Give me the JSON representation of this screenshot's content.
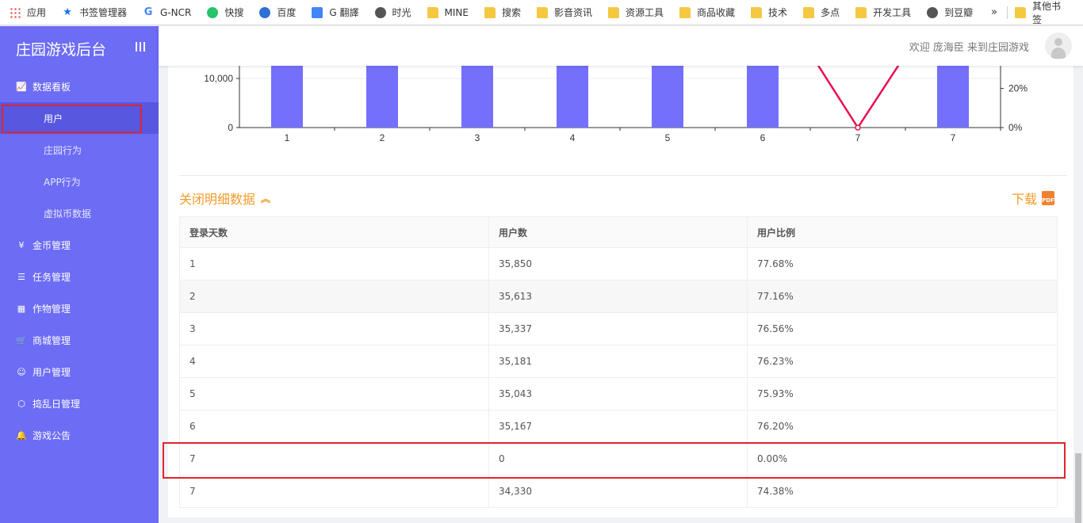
{
  "bookmarks": [
    {
      "label": "应用",
      "icon": "apps-grid-icon",
      "kind": "apps"
    },
    {
      "label": "书签管理器",
      "icon": "star-icon",
      "kind": "star"
    },
    {
      "label": "G-NCR",
      "icon": "google-icon",
      "kind": "g"
    },
    {
      "label": "快搜",
      "icon": "kuaisou-icon",
      "kind": "kuai"
    },
    {
      "label": "百度",
      "icon": "baidu-icon",
      "kind": "bai"
    },
    {
      "label": "G 翻譯",
      "icon": "translate-icon",
      "kind": "tr"
    },
    {
      "label": "时光",
      "icon": "globe-icon",
      "kind": "glob"
    },
    {
      "label": "MINE",
      "icon": "folder-icon",
      "kind": "folder"
    },
    {
      "label": "搜索",
      "icon": "folder-icon",
      "kind": "folder"
    },
    {
      "label": "影音资讯",
      "icon": "folder-icon",
      "kind": "folder"
    },
    {
      "label": "资源工具",
      "icon": "folder-icon",
      "kind": "folder"
    },
    {
      "label": "商品收藏",
      "icon": "folder-icon",
      "kind": "folder"
    },
    {
      "label": "技术",
      "icon": "folder-icon",
      "kind": "folder"
    },
    {
      "label": "多点",
      "icon": "folder-icon",
      "kind": "folder"
    },
    {
      "label": "开发工具",
      "icon": "folder-icon",
      "kind": "folder"
    },
    {
      "label": "到豆瓣",
      "icon": "globe-icon",
      "kind": "glob"
    }
  ],
  "bookmarks_more": "»",
  "bookmarks_other": "其他书签",
  "sidebar": {
    "title": "庄园游戏后台",
    "menu": [
      {
        "label": "数据看板",
        "icon": "line-chart-icon",
        "glyph": "📈"
      },
      {
        "label": "金币管理",
        "icon": "coin-icon",
        "glyph": "¥"
      },
      {
        "label": "任务管理",
        "icon": "task-list-icon",
        "glyph": "☰"
      },
      {
        "label": "作物管理",
        "icon": "crop-grid-icon",
        "glyph": "▦"
      },
      {
        "label": "商城管理",
        "icon": "cart-icon",
        "glyph": "🛒"
      },
      {
        "label": "用户管理",
        "icon": "user-circle-icon",
        "glyph": "☺"
      },
      {
        "label": "捣乱日管理",
        "icon": "cube-icon",
        "glyph": "⬡"
      },
      {
        "label": "游戏公告",
        "icon": "bell-icon",
        "glyph": "🔔"
      }
    ],
    "submenu": [
      "用户",
      "庄园行为",
      "APP行为",
      "虚拟币数据"
    ]
  },
  "header": {
    "welcome": "欢迎 庞海臣 来到庄园游戏"
  },
  "chart_data": {
    "type": "bar",
    "categories": [
      "1",
      "2",
      "3",
      "4",
      "5",
      "6",
      "7",
      "7"
    ],
    "series": [
      {
        "values": [
          35850,
          35613,
          35337,
          35181,
          35043,
          35167,
          0,
          34330
        ]
      },
      {
        "values": [
          77.68,
          77.16,
          76.56,
          76.23,
          75.93,
          76.2,
          0.0,
          74.38
        ]
      }
    ],
    "y_ticks_left": [
      "0",
      "10,000"
    ],
    "y_ticks_right": [
      "0%",
      "20%"
    ],
    "bar_color": "#7470fc",
    "line_color": "#e8104f"
  },
  "detail": {
    "title": "关闭明细数据",
    "download": "下载",
    "pdf_badge": "PDF"
  },
  "table": {
    "headers": [
      "登录天数",
      "用户数",
      "用户比例"
    ],
    "rows": [
      [
        "1",
        "35,850",
        "77.68%"
      ],
      [
        "2",
        "35,613",
        "77.16%"
      ],
      [
        "3",
        "35,337",
        "76.56%"
      ],
      [
        "4",
        "35,181",
        "76.23%"
      ],
      [
        "5",
        "35,043",
        "75.93%"
      ],
      [
        "6",
        "35,167",
        "76.20%"
      ],
      [
        "7",
        "0",
        "0.00%"
      ],
      [
        "7",
        "34,330",
        "74.38%"
      ]
    ]
  }
}
